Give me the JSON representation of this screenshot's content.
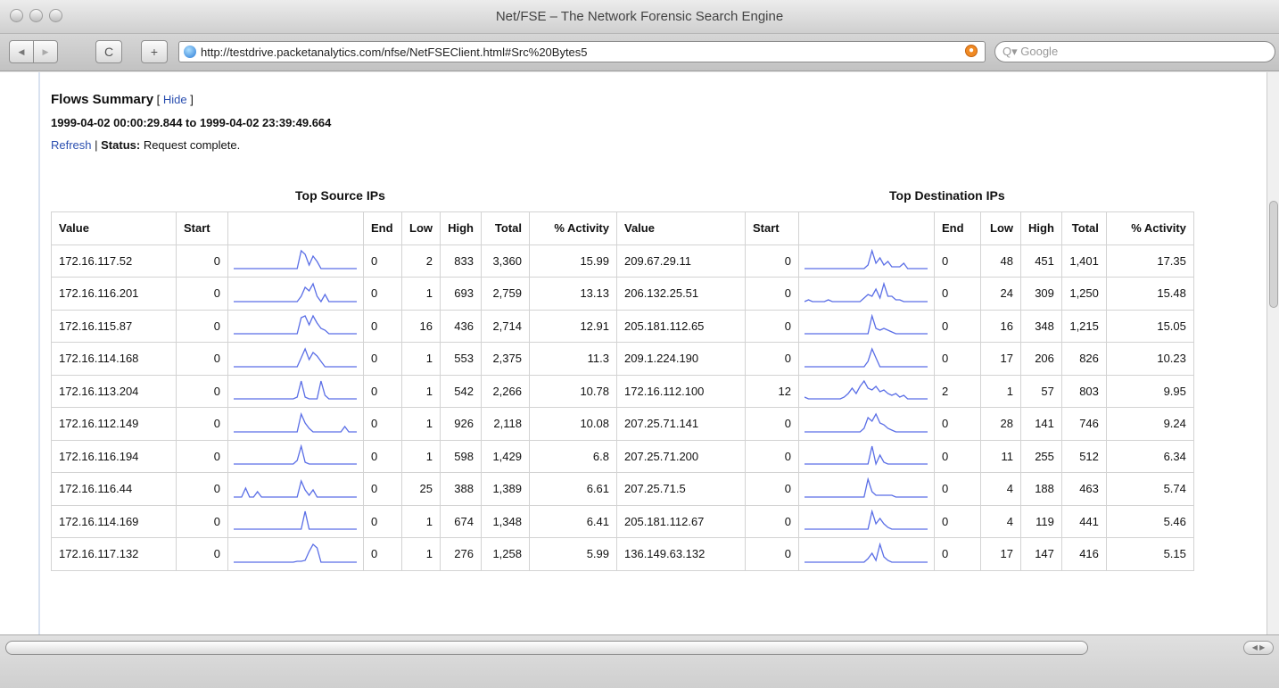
{
  "window": {
    "title": "Net/FSE – The Network Forensic Search Engine"
  },
  "toolbar": {
    "back_label": "◀",
    "forward_label": "▶",
    "reload_label": "C",
    "add_label": "+",
    "url": "http://testdrive.packetanalytics.com/nfse/NetFSEClient.html#Src%20Bytes5",
    "search_placeholder": "Q▾ Google"
  },
  "page": {
    "heading": "Flows Summary",
    "hide_prefix": " [ ",
    "hide_link": "Hide",
    "hide_suffix": " ]",
    "date_range": "1999-04-02 00:00:29.844 to 1999-04-02 23:39:49.664",
    "refresh_link": "Refresh",
    "separator": " | ",
    "status_label": "Status:",
    "status_text": " Request complete."
  },
  "source_table": {
    "caption": "Top Source IPs",
    "headers": [
      "Value",
      "Start",
      "",
      "End",
      "Low",
      "High",
      "Total",
      "% Activity"
    ],
    "rows": [
      {
        "value": "172.16.117.52",
        "start": "0",
        "end": "0",
        "low": "2",
        "high": "833",
        "total": "3,360",
        "activity": "15.99"
      },
      {
        "value": "172.16.116.201",
        "start": "0",
        "end": "0",
        "low": "1",
        "high": "693",
        "total": "2,759",
        "activity": "13.13"
      },
      {
        "value": "172.16.115.87",
        "start": "0",
        "end": "0",
        "low": "16",
        "high": "436",
        "total": "2,714",
        "activity": "12.91"
      },
      {
        "value": "172.16.114.168",
        "start": "0",
        "end": "0",
        "low": "1",
        "high": "553",
        "total": "2,375",
        "activity": "11.3"
      },
      {
        "value": "172.16.113.204",
        "start": "0",
        "end": "0",
        "low": "1",
        "high": "542",
        "total": "2,266",
        "activity": "10.78"
      },
      {
        "value": "172.16.112.149",
        "start": "0",
        "end": "0",
        "low": "1",
        "high": "926",
        "total": "2,118",
        "activity": "10.08"
      },
      {
        "value": "172.16.116.194",
        "start": "0",
        "end": "0",
        "low": "1",
        "high": "598",
        "total": "1,429",
        "activity": "6.8"
      },
      {
        "value": "172.16.116.44",
        "start": "0",
        "end": "0",
        "low": "25",
        "high": "388",
        "total": "1,389",
        "activity": "6.61"
      },
      {
        "value": "172.16.114.169",
        "start": "0",
        "end": "0",
        "low": "1",
        "high": "674",
        "total": "1,348",
        "activity": "6.41"
      },
      {
        "value": "172.16.117.132",
        "start": "0",
        "end": "0",
        "low": "1",
        "high": "276",
        "total": "1,258",
        "activity": "5.99"
      }
    ]
  },
  "dest_table": {
    "caption": "Top Destination IPs",
    "headers": [
      "Value",
      "Start",
      "",
      "End",
      "Low",
      "High",
      "Total",
      "% Activity"
    ],
    "rows": [
      {
        "value": "209.67.29.11",
        "start": "0",
        "end": "0",
        "low": "48",
        "high": "451",
        "total": "1,401",
        "activity": "17.35"
      },
      {
        "value": "206.132.25.51",
        "start": "0",
        "end": "0",
        "low": "24",
        "high": "309",
        "total": "1,250",
        "activity": "15.48"
      },
      {
        "value": "205.181.112.65",
        "start": "0",
        "end": "0",
        "low": "16",
        "high": "348",
        "total": "1,215",
        "activity": "15.05"
      },
      {
        "value": "209.1.224.190",
        "start": "0",
        "end": "0",
        "low": "17",
        "high": "206",
        "total": "826",
        "activity": "10.23"
      },
      {
        "value": "172.16.112.100",
        "start": "12",
        "end": "2",
        "low": "1",
        "high": "57",
        "total": "803",
        "activity": "9.95"
      },
      {
        "value": "207.25.71.141",
        "start": "0",
        "end": "0",
        "low": "28",
        "high": "141",
        "total": "746",
        "activity": "9.24"
      },
      {
        "value": "207.25.71.200",
        "start": "0",
        "end": "0",
        "low": "11",
        "high": "255",
        "total": "512",
        "activity": "6.34"
      },
      {
        "value": "207.25.71.5",
        "start": "0",
        "end": "0",
        "low": "4",
        "high": "188",
        "total": "463",
        "activity": "5.74"
      },
      {
        "value": "205.181.112.67",
        "start": "0",
        "end": "0",
        "low": "4",
        "high": "119",
        "total": "441",
        "activity": "5.46"
      },
      {
        "value": "136.149.63.132",
        "start": "0",
        "end": "0",
        "low": "17",
        "high": "147",
        "total": "416",
        "activity": "5.15"
      }
    ]
  },
  "sparkline_color": "#5a6ee6",
  "sparklines": {
    "source": [
      [
        0,
        0,
        0,
        0,
        0,
        0,
        0,
        0,
        0,
        0,
        0,
        0,
        0,
        0,
        0,
        0,
        0,
        1,
        0.8,
        0.2,
        0.7,
        0.4,
        0,
        0,
        0,
        0,
        0,
        0,
        0,
        0,
        0,
        0
      ],
      [
        0,
        0,
        0,
        0,
        0,
        0,
        0,
        0,
        0,
        0,
        0,
        0,
        0,
        0,
        0,
        0,
        0,
        0.3,
        0.8,
        0.6,
        1,
        0.3,
        0,
        0.4,
        0,
        0,
        0,
        0,
        0,
        0,
        0,
        0
      ],
      [
        0,
        0,
        0,
        0,
        0,
        0,
        0,
        0,
        0,
        0,
        0,
        0,
        0,
        0,
        0,
        0,
        0,
        0.9,
        1,
        0.5,
        1,
        0.6,
        0.3,
        0.2,
        0,
        0,
        0,
        0,
        0,
        0,
        0,
        0
      ],
      [
        0,
        0,
        0,
        0,
        0,
        0,
        0,
        0,
        0,
        0,
        0,
        0,
        0,
        0,
        0,
        0,
        0,
        0.5,
        1,
        0.4,
        0.8,
        0.6,
        0.3,
        0,
        0,
        0,
        0,
        0,
        0,
        0,
        0,
        0
      ],
      [
        0,
        0,
        0,
        0,
        0,
        0,
        0,
        0,
        0,
        0,
        0,
        0,
        0,
        0,
        0,
        0,
        0.1,
        1,
        0.1,
        0,
        0,
        0,
        1,
        0.2,
        0,
        0,
        0,
        0,
        0,
        0,
        0,
        0
      ],
      [
        0,
        0,
        0,
        0,
        0,
        0,
        0,
        0,
        0,
        0,
        0,
        0,
        0,
        0,
        0,
        0,
        0,
        1,
        0.5,
        0.2,
        0,
        0,
        0,
        0,
        0,
        0,
        0,
        0,
        0.3,
        0,
        0,
        0
      ],
      [
        0,
        0,
        0,
        0,
        0,
        0,
        0,
        0,
        0,
        0,
        0,
        0,
        0,
        0,
        0,
        0,
        0.2,
        1,
        0.1,
        0,
        0,
        0,
        0,
        0,
        0,
        0,
        0,
        0,
        0,
        0,
        0,
        0
      ],
      [
        0,
        0,
        0,
        0.5,
        0,
        0,
        0.3,
        0,
        0,
        0,
        0,
        0,
        0,
        0,
        0,
        0,
        0,
        0.9,
        0.4,
        0.1,
        0.4,
        0,
        0,
        0,
        0,
        0,
        0,
        0,
        0,
        0,
        0,
        0
      ],
      [
        0,
        0,
        0,
        0,
        0,
        0,
        0,
        0,
        0,
        0,
        0,
        0,
        0,
        0,
        0,
        0,
        0,
        0,
        1,
        0,
        0,
        0,
        0,
        0,
        0,
        0,
        0,
        0,
        0,
        0,
        0,
        0
      ],
      [
        0,
        0,
        0,
        0,
        0,
        0,
        0,
        0,
        0,
        0,
        0,
        0,
        0,
        0,
        0,
        0,
        0.05,
        0.05,
        0.1,
        0.6,
        1,
        0.8,
        0,
        0,
        0,
        0,
        0,
        0,
        0,
        0,
        0,
        0
      ]
    ],
    "dest": [
      [
        0,
        0,
        0,
        0,
        0,
        0,
        0,
        0,
        0,
        0,
        0,
        0,
        0,
        0,
        0,
        0,
        0.2,
        1,
        0.3,
        0.6,
        0.2,
        0.4,
        0.1,
        0.1,
        0.1,
        0.3,
        0,
        0,
        0,
        0,
        0,
        0
      ],
      [
        0,
        0.1,
        0,
        0,
        0,
        0,
        0.1,
        0,
        0,
        0,
        0,
        0,
        0,
        0,
        0,
        0.2,
        0.4,
        0.3,
        0.7,
        0.2,
        1,
        0.3,
        0.3,
        0.1,
        0.1,
        0,
        0,
        0,
        0,
        0,
        0,
        0
      ],
      [
        0,
        0,
        0,
        0,
        0,
        0,
        0,
        0,
        0,
        0,
        0,
        0,
        0,
        0,
        0,
        0,
        0,
        1,
        0.3,
        0.2,
        0.3,
        0.2,
        0.1,
        0,
        0,
        0,
        0,
        0,
        0,
        0,
        0,
        0
      ],
      [
        0,
        0,
        0,
        0,
        0,
        0,
        0,
        0,
        0,
        0,
        0,
        0,
        0,
        0,
        0,
        0,
        0.3,
        1,
        0.5,
        0,
        0,
        0,
        0,
        0,
        0,
        0,
        0,
        0,
        0,
        0,
        0,
        0
      ],
      [
        0.1,
        0,
        0,
        0,
        0,
        0,
        0,
        0,
        0,
        0,
        0.1,
        0.3,
        0.6,
        0.3,
        0.7,
        1,
        0.6,
        0.5,
        0.7,
        0.4,
        0.5,
        0.3,
        0.2,
        0.3,
        0.1,
        0.2,
        0,
        0,
        0,
        0,
        0,
        0
      ],
      [
        0,
        0,
        0,
        0,
        0,
        0,
        0,
        0,
        0,
        0,
        0,
        0,
        0,
        0,
        0,
        0.2,
        0.8,
        0.6,
        1,
        0.5,
        0.4,
        0.2,
        0.1,
        0,
        0,
        0,
        0,
        0,
        0,
        0,
        0,
        0
      ],
      [
        0,
        0,
        0,
        0,
        0,
        0,
        0,
        0,
        0,
        0,
        0,
        0,
        0,
        0,
        0,
        0,
        0,
        1,
        0,
        0.5,
        0.1,
        0,
        0,
        0,
        0,
        0,
        0,
        0,
        0,
        0,
        0,
        0
      ],
      [
        0,
        0,
        0,
        0,
        0,
        0,
        0,
        0,
        0,
        0,
        0,
        0,
        0,
        0,
        0,
        0,
        1,
        0.3,
        0.1,
        0.1,
        0.1,
        0.1,
        0.1,
        0,
        0,
        0,
        0,
        0,
        0,
        0,
        0,
        0
      ],
      [
        0,
        0,
        0,
        0,
        0,
        0,
        0,
        0,
        0,
        0,
        0,
        0,
        0,
        0,
        0,
        0,
        0,
        1,
        0.3,
        0.6,
        0.3,
        0.1,
        0,
        0,
        0,
        0,
        0,
        0,
        0,
        0,
        0,
        0
      ],
      [
        0,
        0,
        0,
        0,
        0,
        0,
        0,
        0,
        0,
        0,
        0,
        0,
        0,
        0,
        0,
        0,
        0.2,
        0.5,
        0.1,
        1,
        0.3,
        0.1,
        0,
        0,
        0,
        0,
        0,
        0,
        0,
        0,
        0,
        0
      ]
    ]
  }
}
